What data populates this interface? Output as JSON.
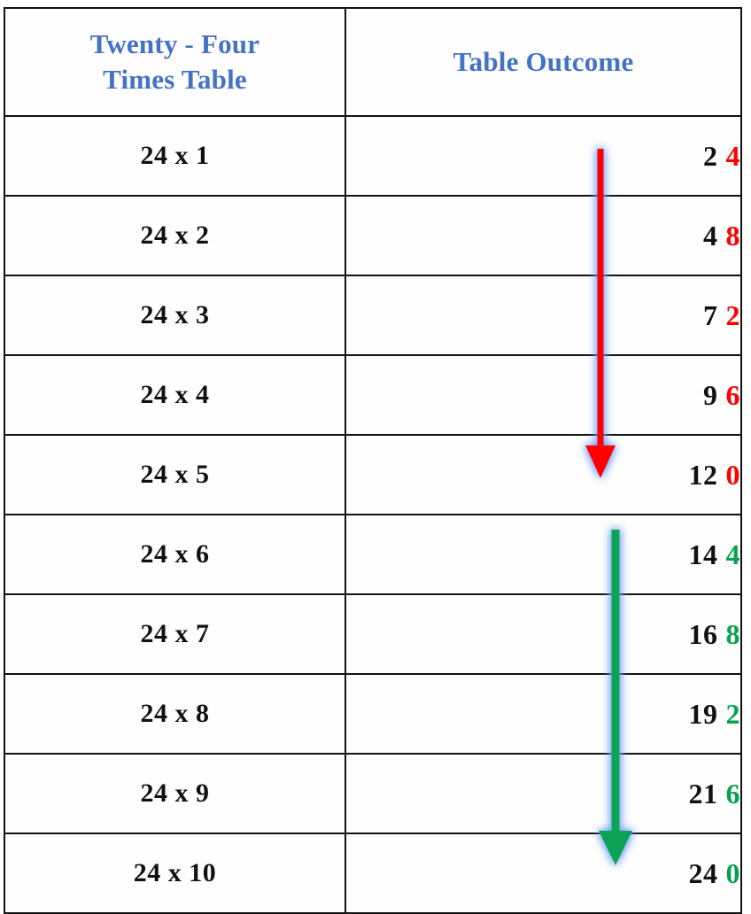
{
  "table": {
    "headers": {
      "left_line1": "Twenty - Four",
      "left_line2": "Times Table",
      "right": "Table Outcome"
    },
    "rows": [
      {
        "expression": "24 x 1",
        "outcome_head": "2",
        "outcome_tail": "4",
        "tail_color": "#ff0000"
      },
      {
        "expression": "24 x 2",
        "outcome_head": "4",
        "outcome_tail": "8",
        "tail_color": "#ff0000"
      },
      {
        "expression": "24 x 3",
        "outcome_head": "7",
        "outcome_tail": "2",
        "tail_color": "#ff0000"
      },
      {
        "expression": "24 x 4",
        "outcome_head": "9",
        "outcome_tail": "6",
        "tail_color": "#ff0000"
      },
      {
        "expression": "24 x 5",
        "outcome_head": "12",
        "outcome_tail": "0",
        "tail_color": "#ff0000"
      },
      {
        "expression": "24 x 6",
        "outcome_head": "14",
        "outcome_tail": "4",
        "tail_color": "#08a24f"
      },
      {
        "expression": "24 x 7",
        "outcome_head": "16",
        "outcome_tail": "8",
        "tail_color": "#08a24f"
      },
      {
        "expression": "24 x 8",
        "outcome_head": "19",
        "outcome_tail": "2",
        "tail_color": "#08a24f"
      },
      {
        "expression": "24 x 9",
        "outcome_head": "21",
        "outcome_tail": "6",
        "tail_color": "#08a24f"
      },
      {
        "expression": "24 x 10",
        "outcome_head": "24",
        "outcome_tail": "0",
        "tail_color": "#08a24f"
      }
    ]
  },
  "annotations": {
    "red_arrow": {
      "name": "downward-red-arrow",
      "color": "#ff0000",
      "glow_color": "#7aa7f5",
      "covers_rows": "24 x 1 through 24 x 5"
    },
    "green_arrow": {
      "name": "downward-green-arrow",
      "color": "#0ba355",
      "glow_color": "#7aa7f5",
      "covers_rows": "24 x 6 through 24 x 10"
    }
  },
  "colors": {
    "header_blue": "#4472c4",
    "text_black": "#111111",
    "red": "#ff0000",
    "green": "#08a24f",
    "border": "#111111",
    "background": "#ffffff"
  }
}
